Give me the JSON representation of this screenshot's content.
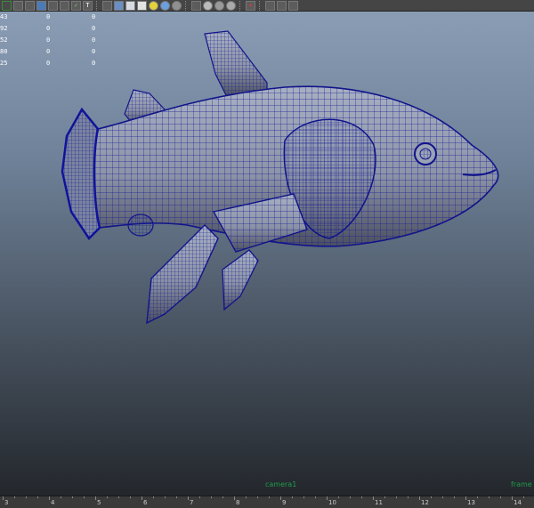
{
  "toolbar": {
    "buttons": [
      {
        "name": "object-mode-icon",
        "glyph": ""
      },
      {
        "name": "wireframe-shaded-icon",
        "glyph": ""
      },
      {
        "name": "grid-icon",
        "glyph": ""
      },
      {
        "name": "isolate-icon",
        "glyph": ""
      },
      {
        "name": "texture-icon",
        "glyph": ""
      },
      {
        "name": "xray-icon",
        "glyph": ""
      },
      {
        "name": "resolution-gate-icon",
        "glyph": ""
      },
      {
        "name": "text-icon",
        "glyph": "T"
      }
    ]
  },
  "hud": {
    "rows": [
      {
        "label": "43",
        "c1": "0",
        "c2": "0"
      },
      {
        "label": "92",
        "c1": "0",
        "c2": "0"
      },
      {
        "label": "52",
        "c1": "0",
        "c2": "0"
      },
      {
        "label": "80",
        "c1": "0",
        "c2": "0"
      },
      {
        "label": "25",
        "c1": "0",
        "c2": "0"
      }
    ]
  },
  "viewport": {
    "camera_label": "camera1",
    "frame_label": "frame"
  },
  "timeline": {
    "ticks": [
      "3",
      "4",
      "5",
      "6",
      "7",
      "8",
      "9",
      "10",
      "11",
      "12",
      "13",
      "14"
    ]
  }
}
